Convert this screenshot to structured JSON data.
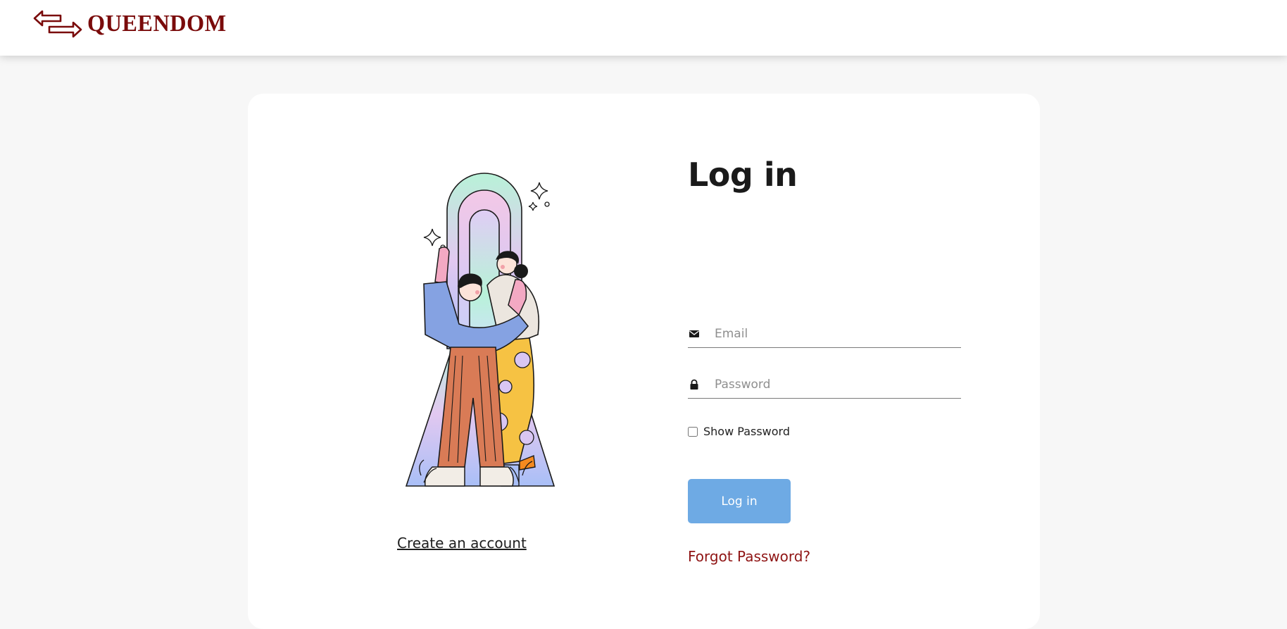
{
  "header": {
    "logo_text": "QUEENDOM",
    "logo_icon": "exchange-arrows-icon",
    "brand_color": "#7a0b0b"
  },
  "illustration": {
    "name": "two-people-rainbow-arch-illustration"
  },
  "links": {
    "create_account": "Create an account",
    "forgot_password": "Forgot Password?"
  },
  "form": {
    "title": "Log in",
    "email": {
      "placeholder": "Email",
      "value": "",
      "icon": "envelope-icon"
    },
    "password": {
      "placeholder": "Password",
      "value": "",
      "icon": "lock-icon"
    },
    "show_password_label": "Show Password",
    "show_password_checked": false,
    "submit_label": "Log in"
  },
  "colors": {
    "page_bg": "#f7f7f7",
    "card_bg": "#ffffff",
    "button_bg": "#6eaae4",
    "link_red": "#8f1414"
  }
}
